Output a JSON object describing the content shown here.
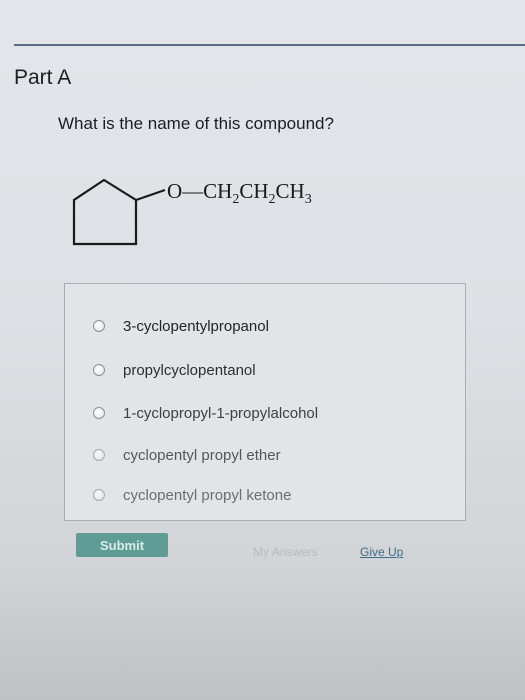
{
  "part": {
    "title": "Part A"
  },
  "question": {
    "text": "What is the name of this compound?"
  },
  "structure": {
    "substituent": {
      "o": "O",
      "bond": "—",
      "ch": "CH",
      "sub2": "2",
      "ch3": "CH",
      "sub3": "3"
    }
  },
  "options": [
    {
      "label": "3-cyclopentylpropanol"
    },
    {
      "label": "propylcyclopentanol"
    },
    {
      "label": "1-cyclopropyl-1-propylalcohol"
    },
    {
      "label": "cyclopentyl propyl ether"
    },
    {
      "label": "cyclopentyl propyl ketone"
    }
  ],
  "actions": {
    "submit_label": "Submit",
    "my_answers_label": "My Answers",
    "give_up_label": "Give Up"
  },
  "colors": {
    "submit_button": "#5f9c95",
    "link": "#3f6c86",
    "header_rule": "#5c6f86"
  }
}
